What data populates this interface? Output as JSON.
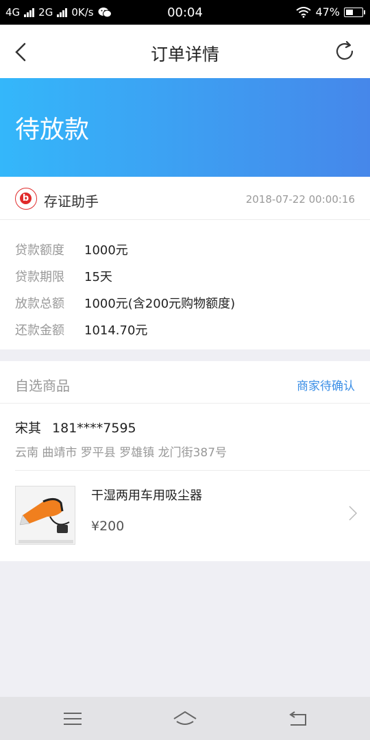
{
  "status_bar": {
    "network1": "4G",
    "network2": "2G",
    "speed": "0K/s",
    "time": "00:04",
    "battery": "47%",
    "battery_level": 0.47
  },
  "nav": {
    "title": "订单详情",
    "back_icon": "chevron-left-icon",
    "refresh_icon": "refresh-icon"
  },
  "banner": {
    "status": "待放款",
    "colors": [
      "#34b7fa",
      "#4687ea"
    ]
  },
  "merchant": {
    "name": "存证助手",
    "logo_letter": "b",
    "order_time": "2018-07-22 00:00:16"
  },
  "loan": {
    "rows": [
      {
        "label": "贷款额度",
        "value": "1000元"
      },
      {
        "label": "贷款期限",
        "value": "15天"
      },
      {
        "label": "放款总额",
        "value": "1000元(含200元购物额度)"
      },
      {
        "label": "还款金额",
        "value": "1014.70元"
      }
    ]
  },
  "goods": {
    "title": "自选商品",
    "state": "商家待确认",
    "state_color": "#3a8ee6",
    "contact_name": "宋其",
    "contact_phone": "181****7595",
    "address": "云南 曲靖市 罗平县 罗雄镇 龙门街387号",
    "product_name": "干湿两用车用吸尘器",
    "product_price": "¥200"
  },
  "bottom_nav": {
    "icons": [
      "menu-icon",
      "home-icon",
      "back-icon"
    ]
  }
}
